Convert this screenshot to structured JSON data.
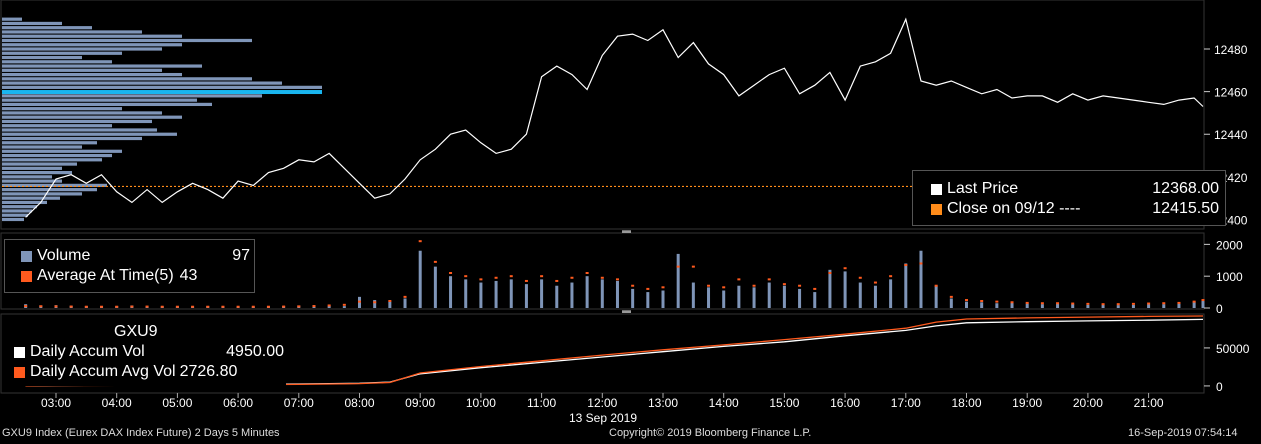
{
  "footer": {
    "left": "GXU9 Index (Eurex DAX Index Future) 2 Days 5 Minutes",
    "center": "Copyright© 2019 Bloomberg Finance L.P.",
    "right": "16-Sep-2019 07:54:14"
  },
  "colors": {
    "background": "#000000",
    "price": "#ffffff",
    "volume": "#7f95b8",
    "average": "#ff5a1e",
    "close": "#ff8c1a",
    "profile": "#7f95b8",
    "profile_highlight": "#19b6f0"
  },
  "price_legend": {
    "items": [
      {
        "label": "Last Price",
        "value": "12368.00",
        "color": "#ffffff"
      },
      {
        "label": "Close on 09/12 ---- ",
        "value": "12415.50",
        "color": "#ff8c1a"
      }
    ]
  },
  "volume_legend": {
    "items": [
      {
        "label": "Volume",
        "value": "97",
        "color": "#7f95b8"
      },
      {
        "label": "Average At Time(5)",
        "value": "43",
        "color": "#ff5a1e"
      }
    ]
  },
  "accum_legend": {
    "ticker": "GXU9",
    "items": [
      {
        "label": "Daily Accum Vol",
        "value": "4950.00",
        "color": "#ffffff"
      },
      {
        "label": "Daily Accum Avg Vol",
        "value": "2726.80",
        "color": "#ff5a1e"
      }
    ]
  },
  "chart_data": [
    {
      "type": "line",
      "name": "price",
      "x_hours": [
        2.5,
        2.75,
        3,
        3.25,
        3.5,
        3.75,
        4,
        4.25,
        4.5,
        4.75,
        5,
        5.25,
        5.5,
        5.75,
        6,
        6.25,
        6.5,
        6.75,
        7,
        7.25,
        7.5,
        7.75,
        8,
        8.25,
        8.5,
        8.75,
        9,
        9.25,
        9.5,
        9.75,
        10,
        10.25,
        10.5,
        10.75,
        11,
        11.25,
        11.5,
        11.75,
        12,
        12.25,
        12.5,
        12.75,
        13,
        13.25,
        13.5,
        13.75,
        14,
        14.25,
        14.5,
        14.75,
        15,
        15.25,
        15.5,
        15.75,
        16,
        16.25,
        16.5,
        16.75,
        17,
        17.25,
        17.5,
        17.75,
        18,
        18.25,
        18.5,
        18.75,
        19,
        19.25,
        19.5,
        19.75,
        20,
        20.25,
        20.5,
        20.75,
        21,
        21.25,
        21.5,
        21.75,
        22
      ],
      "values": [
        12401,
        12408,
        12419,
        12421,
        12417,
        12421,
        12413,
        12408,
        12414,
        12408,
        12413,
        12417,
        12414,
        12410,
        12418,
        12416,
        12422,
        12424,
        12428,
        12427,
        12431,
        12424,
        12417,
        12410,
        12412,
        12419,
        12428,
        12433,
        12440,
        12442,
        12436,
        12431,
        12433,
        12440,
        12467,
        12472,
        12468,
        12461,
        12477,
        12486,
        12487,
        12484,
        12489,
        12476,
        12483,
        12473,
        12468,
        12458,
        12463,
        12468,
        12471,
        12459,
        12463,
        12469,
        12456,
        12472,
        12474,
        12478,
        12494,
        12465,
        12463,
        12465,
        12462,
        12459,
        12461,
        12457,
        12458,
        12458,
        12455,
        12459,
        12456,
        12458,
        12457,
        12456,
        12455,
        12454,
        12456,
        12457,
        12453
      ],
      "title": "",
      "x_axis": {
        "ticks": [
          "03:00",
          "04:00",
          "05:00",
          "06:00",
          "07:00",
          "08:00",
          "09:00",
          "10:00",
          "11:00",
          "12:00",
          "13:00",
          "14:00",
          "15:00",
          "16:00",
          "17:00",
          "18:00",
          "19:00",
          "20:00",
          "21:00"
        ],
        "date_label": "13 Sep 2019"
      },
      "y_axis": {
        "ticks": [
          12400,
          12420,
          12440,
          12460,
          12480
        ],
        "range": [
          12396,
          12503
        ]
      },
      "close_line": 12415.5
    },
    {
      "type": "bar",
      "name": "volume-profile",
      "price_levels": [
        12400,
        12402,
        12404,
        12406,
        12408,
        12410,
        12412,
        12414,
        12416,
        12418,
        12420,
        12422,
        12424,
        12426,
        12428,
        12430,
        12432,
        12434,
        12436,
        12438,
        12440,
        12442,
        12444,
        12446,
        12448,
        12450,
        12452,
        12454,
        12456,
        12458,
        12460,
        12462,
        12464,
        12466,
        12468,
        12470,
        12472,
        12474,
        12476,
        12478,
        12480,
        12482,
        12484,
        12486,
        12488,
        12490,
        12492,
        12494
      ],
      "values": [
        22,
        26,
        30,
        35,
        45,
        58,
        80,
        95,
        105,
        60,
        50,
        70,
        60,
        75,
        100,
        110,
        120,
        80,
        95,
        140,
        175,
        155,
        110,
        150,
        180,
        160,
        120,
        210,
        195,
        260,
        320,
        320,
        280,
        250,
        180,
        160,
        200,
        110,
        80,
        120,
        160,
        180,
        250,
        180,
        140,
        90,
        60,
        20
      ],
      "highlight_level": 12460
    },
    {
      "type": "bar",
      "name": "volume",
      "y_axis": {
        "ticks": [
          0,
          1000,
          2000
        ],
        "range": [
          0,
          2200
        ]
      },
      "x_hours": [
        2.5,
        2.75,
        3,
        3.25,
        3.5,
        3.75,
        4,
        4.25,
        4.5,
        4.75,
        5,
        5.25,
        5.5,
        5.75,
        6,
        6.25,
        6.5,
        6.75,
        7,
        7.25,
        7.5,
        7.75,
        8,
        8.25,
        8.5,
        8.75,
        9,
        9.25,
        9.5,
        9.75,
        10,
        10.25,
        10.5,
        10.75,
        11,
        11.25,
        11.5,
        11.75,
        12,
        12.25,
        12.5,
        12.75,
        13,
        13.25,
        13.5,
        13.75,
        14,
        14.25,
        14.5,
        14.75,
        15,
        15.25,
        15.5,
        15.75,
        16,
        16.25,
        16.5,
        16.75,
        17,
        17.25,
        17.5,
        17.75,
        18,
        18.25,
        18.5,
        18.75,
        19,
        19.25,
        19.5,
        19.75,
        20,
        20.25,
        20.5,
        20.75,
        21,
        21.25,
        21.5,
        21.75,
        22
      ],
      "values": [
        120,
        80,
        90,
        70,
        60,
        50,
        60,
        80,
        60,
        50,
        50,
        40,
        60,
        50,
        40,
        40,
        50,
        60,
        80,
        90,
        70,
        60,
        350,
        250,
        200,
        300,
        1800,
        1300,
        1000,
        900,
        800,
        850,
        900,
        750,
        900,
        700,
        800,
        1000,
        900,
        850,
        600,
        500,
        550,
        1700,
        800,
        650,
        550,
        700,
        650,
        800,
        700,
        600,
        500,
        1200,
        1150,
        800,
        700,
        900,
        1400,
        1800,
        700,
        300,
        200,
        180,
        150,
        160,
        140,
        120,
        130,
        120,
        100,
        110,
        90,
        100,
        110,
        120,
        140,
        200,
        250
      ],
      "average": [
        60,
        55,
        50,
        45,
        40,
        40,
        40,
        45,
        45,
        40,
        40,
        40,
        40,
        40,
        40,
        40,
        40,
        45,
        50,
        60,
        80,
        100,
        200,
        180,
        220,
        350,
        2100,
        1450,
        1100,
        1000,
        900,
        950,
        1000,
        850,
        1000,
        850,
        950,
        1100,
        950,
        900,
        700,
        600,
        650,
        1300,
        1300,
        700,
        650,
        900,
        700,
        900,
        750,
        700,
        600,
        1100,
        1250,
        950,
        800,
        1000,
        1350,
        1400,
        700,
        350,
        250,
        220,
        200,
        180,
        160,
        150,
        150,
        140,
        130,
        120,
        120,
        130,
        140,
        150,
        160,
        200,
        250
      ]
    },
    {
      "type": "line",
      "name": "accumulated-volume",
      "y_axis": {
        "ticks": [
          0,
          50000
        ],
        "range": [
          -8000,
          92000
        ]
      },
      "x_hours": [
        2.5,
        3,
        4,
        5,
        6,
        7,
        8,
        8.5,
        9,
        10,
        11,
        12,
        13,
        14,
        15,
        16,
        17,
        17.5,
        18,
        19,
        20,
        21,
        22
      ],
      "series": [
        {
          "name": "Daily Accum Vol",
          "values": [
            0,
            500,
            1000,
            1500,
            2000,
            2500,
            3500,
            5000,
            16000,
            24000,
            31000,
            38000,
            45000,
            52000,
            58000,
            66000,
            73000,
            79000,
            83000,
            84500,
            85500,
            86500,
            87500
          ]
        },
        {
          "name": "Daily Accum Avg Vol",
          "values": [
            0,
            400,
            800,
            1200,
            1600,
            2000,
            3000,
            4500,
            17000,
            25500,
            33000,
            40500,
            47500,
            54000,
            61000,
            68000,
            76000,
            84000,
            88000,
            89500,
            90500,
            91500,
            92000
          ]
        }
      ]
    }
  ]
}
